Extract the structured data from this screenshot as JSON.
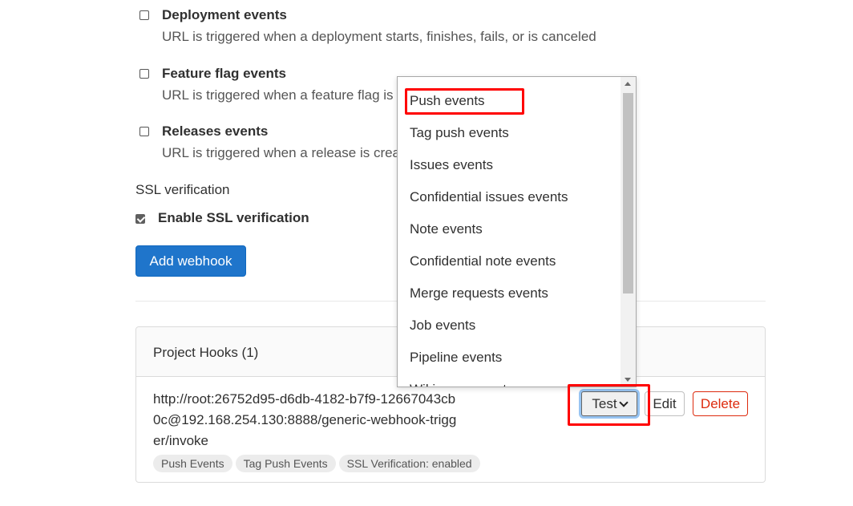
{
  "events": [
    {
      "title": "Deployment events",
      "desc": "URL is triggered when a deployment starts, finishes, fails, or is canceled",
      "checked": false
    },
    {
      "title": "Feature flag events",
      "desc": "URL is triggered when a feature flag is",
      "checked": false
    },
    {
      "title": "Releases events",
      "desc": "URL is triggered when a release is crea",
      "checked": false
    }
  ],
  "ssl": {
    "section_label": "SSL verification",
    "checkbox_label": "Enable SSL verification",
    "checked": true
  },
  "add_button": "Add webhook",
  "hooks": {
    "title": "Project Hooks (1)",
    "url": "http://root:26752d95-d6db-4182-b7f9-12667043cb0c@192.168.254.130:8888/generic-webhook-trigger/invoke",
    "badges": [
      "Push Events",
      "Tag Push Events",
      "SSL Verification: enabled"
    ],
    "test_button": "Test",
    "edit_button": "Edit",
    "delete_button": "Delete"
  },
  "dropdown": {
    "items": [
      "Push events",
      "Tag push events",
      "Issues events",
      "Confidential issues events",
      "Note events",
      "Confidential note events",
      "Merge requests events",
      "Job events",
      "Pipeline events",
      "Wiki page events"
    ]
  },
  "colors": {
    "primary": "#1f75cb",
    "danger": "#dd2b0e",
    "annotation": "#ff0000"
  }
}
